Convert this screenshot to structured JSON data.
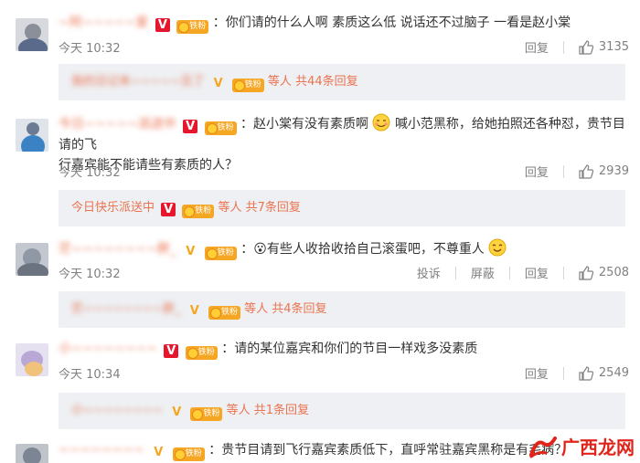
{
  "comments": [
    {
      "username": "~阿~~~~~爱",
      "text": "：你们请的什么人啊 素质这么低 说话还不过脑子 一看是赵小棠",
      "time": "今天 10:32",
      "reply_label": "回复",
      "likes": "3135",
      "thread": {
        "name": "我的日记本~~~~~见了",
        "suffix": "等人",
        "more": "共44条回复"
      }
    },
    {
      "username": "今日~~~~~派送中",
      "text_line1": "：赵小棠有没有素质啊",
      "text_line1b": "喊小范黑称，给她拍照还各种怼，贵节目请的飞",
      "text_line2": "行嘉宾能不能请些有素质的人？",
      "time": "今天 10:32",
      "reply_label": "回复",
      "likes": "2939",
      "thread": {
        "name": "今日快乐派送中",
        "suffix": "等人",
        "more": "共7条回复"
      }
    },
    {
      "username": "茫~~~~~~~~胖_",
      "text": "：😮有些人收拾收拾自己滚蛋吧，不尊重人",
      "time": "今天 10:32",
      "report_label": "投诉",
      "block_label": "屏蔽",
      "reply_label": "回复",
      "likes": "2508",
      "thread": {
        "name": "茫~~~~~~~~胖_",
        "suffix": "等人",
        "more": "共4条回复"
      }
    },
    {
      "username": "小~~~~~~~~",
      "text": "：请的某位嘉宾和你们的节目一样戏多没素质",
      "time": "今天 10:34",
      "reply_label": "回复",
      "likes": "2549",
      "thread": {
        "name": "小~~~~~~~~",
        "suffix": "等人",
        "more": "共1条回复"
      }
    },
    {
      "username": "~~~~~~~~",
      "text": "：贵节目请到飞行嘉宾素质低下，直呼常驻嘉宾黑称是有毛病？"
    }
  ],
  "badges": {
    "vip": "V",
    "fans": "铁粉"
  },
  "watermark": "广西龙网",
  "colors": {
    "accent": "#eb7350",
    "vip_red": "#e6162d",
    "gold": "#f5a623",
    "reply_bg": "#eef0f3"
  },
  "icons": {
    "like": "thumb-up-icon",
    "emoji_blush": "emoji-icon"
  }
}
